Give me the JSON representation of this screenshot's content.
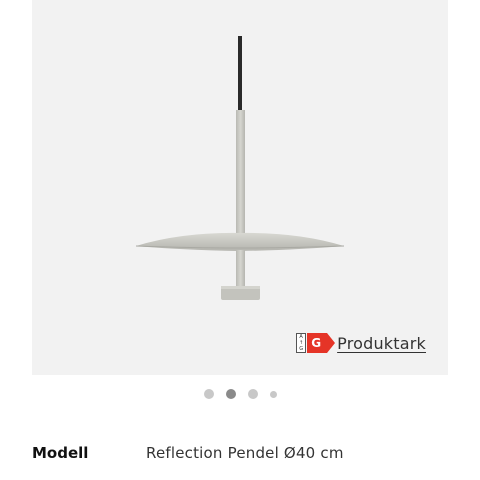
{
  "product": {
    "image_alt": "Reflection Pendel",
    "colors": {
      "image_background": "#f2f2f2",
      "lamp_body": "#c9c9c3",
      "cable": "#2a2a2a",
      "energy_badge": "#e53427"
    }
  },
  "energy_label": {
    "class": "G",
    "scale_letters": [
      "A",
      "↑",
      "G"
    ],
    "link_label": "Produktark",
    "icon": "energy-label-icon"
  },
  "carousel": {
    "slide_count": 4,
    "active_index": 1
  },
  "specs": [
    {
      "label": "Modell",
      "value": "Reflection Pendel Ø40 cm"
    }
  ]
}
